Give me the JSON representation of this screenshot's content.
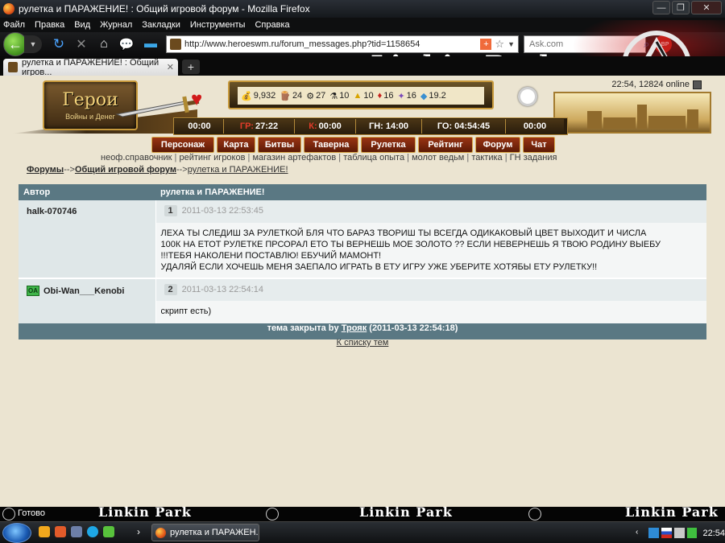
{
  "window": {
    "title": "рулетка и ПАРАЖЕНИЕ! : Общий игровой форум - Mozilla Firefox",
    "min": "—",
    "max": "❐",
    "close": "✕"
  },
  "menu": [
    "Файл",
    "Правка",
    "Вид",
    "Журнал",
    "Закладки",
    "Инструменты",
    "Справка"
  ],
  "nav": {
    "url": "http://www.heroeswm.ru/forum_messages.php?tid=1158654",
    "search_placeholder": "Ask.com",
    "abp_label": "ABP"
  },
  "tab": {
    "label": "рулетка и ПАРАЖЕНИЕ! : Общий игров...",
    "close": "✕",
    "new": "+"
  },
  "banner": {
    "text": "Linkin Park"
  },
  "game": {
    "logo_title": "Герои",
    "logo_sub": "Войны и Денег",
    "online": "22:54, 12824 online",
    "resources": [
      {
        "icon": "gold-icon",
        "glyph": "💰",
        "value": "9,932"
      },
      {
        "icon": "wood-icon",
        "glyph": "🪵",
        "value": "24"
      },
      {
        "icon": "ore-icon",
        "glyph": "⚙",
        "value": "27"
      },
      {
        "icon": "mercury-icon",
        "glyph": "⚗",
        "value": "10"
      },
      {
        "icon": "sulfur-icon",
        "glyph": "▲",
        "value": "10"
      },
      {
        "icon": "crystal-icon",
        "glyph": "♦",
        "value": "16"
      },
      {
        "icon": "gems-icon",
        "glyph": "✦",
        "value": "16"
      },
      {
        "icon": "diamond-icon",
        "glyph": "◆",
        "value": "19.2"
      }
    ],
    "timers": [
      {
        "label": "",
        "value": "00:00"
      },
      {
        "label": "ГР:",
        "value": "27:22"
      },
      {
        "label": "К:",
        "value": "00:00"
      },
      {
        "label": "ГН:",
        "value": "14:00"
      },
      {
        "label": "ГО:",
        "value": "04:54:45"
      },
      {
        "label": "",
        "value": "00:00"
      }
    ],
    "navitems": [
      "Персонаж",
      "Карта",
      "Битвы",
      "Таверна",
      "Рулетка",
      "Рейтинг",
      "Форум",
      "Чат"
    ],
    "sublinks": [
      "неоф.справочник",
      "рейтинг игроков",
      "магазин артефактов",
      "таблица опыта",
      "молот ведьм",
      "тактика",
      "ГН задания"
    ]
  },
  "breadcrumb": {
    "forums": "Форумы",
    "arrow1": "-->",
    "forum": "Общий игровой форум",
    "arrow2": "-->",
    "topic": "рулетка и ПАРАЖЕНИЕ!"
  },
  "table": {
    "col_author": "Автор",
    "col_topic": "рулетка и ПАРАЖЕНИЕ!",
    "posts": [
      {
        "author": "halk-070746",
        "badge": "",
        "num": "1",
        "date": "2011-03-13 22:53:45",
        "lines": [
          "ЛЕХА ТЫ СЛЕДИШ ЗА РУЛЕТКОЙ БЛЯ ЧТО БАРАЗ ТВОРИШ ТЫ ВСЕГДА ОДИКАКОВЫЙ ЦВЕТ ВЫХОДИТ И ЧИСЛА",
          "100К НА ЕТОТ РУЛЕТКЕ ПРСОРАЛ ЕТО ТЫ ВЕРНЕШЬ МОЕ ЗОЛОТО ?? ЕСЛИ НЕВЕРНЕШЬ Я ТВОЮ РОДИНУ ВЫЕБУ",
          "!!!ТЕБЯ НАКОЛЕНИ ПОСТАВЛЮ! ЕБУЧИЙ МАМОНТ!",
          "УДАЛЯЙ ЕСЛИ ХОЧЕШЬ МЕНЯ ЗАЕПАЛО ИГРАТЬ В ЕТУ ИГРУ УЖЕ УБЕРИТЕ ХОТЯБЫ ЕТУ РУЛЕТКУ!!"
        ]
      },
      {
        "author": "Obi-Wan___Kenobi",
        "badge": "OA",
        "num": "2",
        "date": "2011-03-13 22:54:14",
        "lines": [
          "скрипт есть)"
        ]
      }
    ],
    "closed_prefix": "тема закрыта by",
    "closed_user": "Трояк",
    "closed_time": "(2011-03-13 22:54:18)",
    "back_link": "К списку тем"
  },
  "status": {
    "text": "Готово"
  },
  "taskbar": {
    "task_label": "рулетка и ПАРАЖЕН...",
    "arrow": "›",
    "clock": "22:54"
  },
  "colors": {
    "page_bg": "#ebe4d1",
    "table_header": "#5a7883",
    "nav_red": "#9a3413"
  }
}
